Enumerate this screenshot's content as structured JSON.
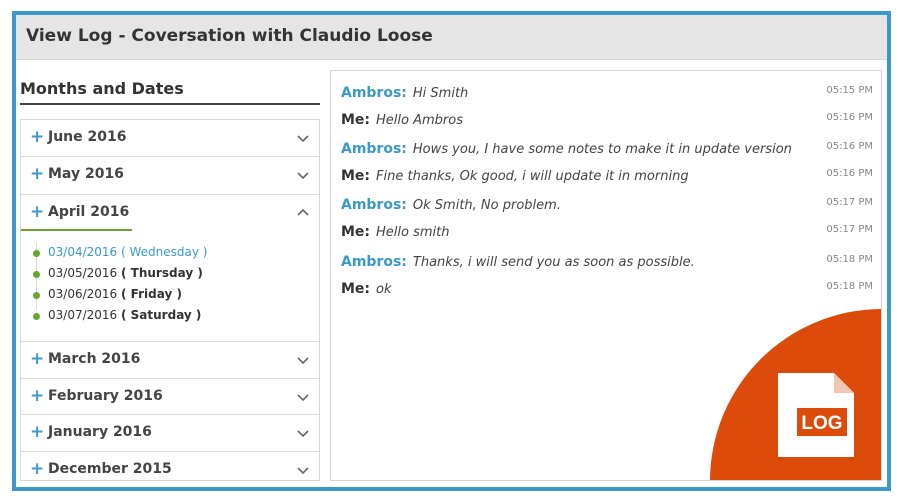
{
  "window": {
    "title": "View Log - Coversation with Claudio Loose"
  },
  "sidebar": {
    "heading": "Months and Dates",
    "months": [
      {
        "label": "June 2016",
        "expanded": false
      },
      {
        "label": "May 2016",
        "expanded": false
      },
      {
        "label": "April 2016",
        "expanded": true,
        "dates": [
          {
            "date": "03/04/2016",
            "day": "( Wednesday )",
            "selected": true
          },
          {
            "date": "03/05/2016",
            "day": "( Thursday )",
            "selected": false
          },
          {
            "date": "03/06/2016",
            "day": "( Friday )",
            "selected": false
          },
          {
            "date": "03/07/2016",
            "day": "( Saturday )",
            "selected": false
          }
        ]
      },
      {
        "label": "March 2016",
        "expanded": false
      },
      {
        "label": "February 2016",
        "expanded": false
      },
      {
        "label": "January 2016",
        "expanded": false
      },
      {
        "label": "December 2015",
        "expanded": false
      }
    ]
  },
  "chat": {
    "messages": [
      {
        "sender": "Ambros:",
        "text": "Hi Smith",
        "time": "05:15 PM",
        "from_me": false
      },
      {
        "sender": "Me:",
        "text": "Hello Ambros",
        "time": "05:16 PM",
        "from_me": true
      },
      {
        "sender": "Ambros:",
        "text": "Hows you, I have some notes to make it in update version",
        "time": "05:16 PM",
        "from_me": false
      },
      {
        "sender": "Me:",
        "text": "Fine thanks, Ok good, i will update it in morning",
        "time": "05:16 PM",
        "from_me": true
      },
      {
        "sender": "Ambros:",
        "text": "Ok Smith, No problem.",
        "time": "05:17 PM",
        "from_me": false
      },
      {
        "sender": "Me:",
        "text": "Hello smith",
        "time": "05:17 PM",
        "from_me": true
      },
      {
        "sender": "Ambros:",
        "text": "Thanks, i will send you as soon as possible.",
        "time": "05:18 PM",
        "from_me": false
      },
      {
        "sender": "Me:",
        "text": "ok",
        "time": "05:18 PM",
        "from_me": true
      }
    ],
    "badge": {
      "label": "LOG",
      "icon": "log-file-icon",
      "color": "#dd4b0a"
    }
  },
  "colors": {
    "accent": "#3a9ac9",
    "tree": "#6aa52c",
    "badge": "#dd4b0a"
  }
}
